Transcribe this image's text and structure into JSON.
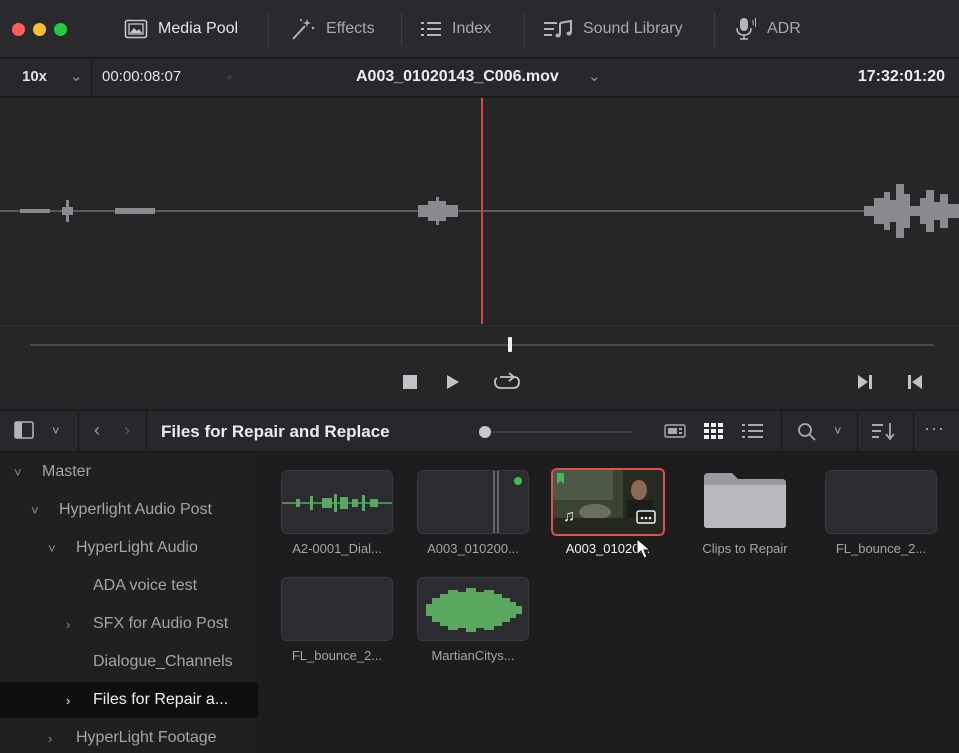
{
  "tabs": [
    {
      "label": "Media Pool",
      "icon": "media-pool-icon",
      "active": true
    },
    {
      "label": "Effects",
      "icon": "effects-wand-icon",
      "active": false
    },
    {
      "label": "Index",
      "icon": "index-list-icon",
      "active": false
    },
    {
      "label": "Sound Library",
      "icon": "sound-library-icon",
      "active": false
    },
    {
      "label": "ADR",
      "icon": "microphone-icon",
      "active": false
    }
  ],
  "viewer": {
    "zoom": "10x",
    "timecode": "00:00:08:07",
    "clip_name": "A003_01020143_C006.mov",
    "timecode_right": "17:32:01:20"
  },
  "media_pool": {
    "bin_title": "Files for Repair and Replace"
  },
  "sidebar": {
    "items": [
      {
        "label": "Master",
        "chev": "˅",
        "depth": 0
      },
      {
        "label": "Hyperlight Audio Post",
        "chev": "˅",
        "depth": 1
      },
      {
        "label": "HyperLight Audio",
        "chev": "˅",
        "depth": 2
      },
      {
        "label": "ADA voice test",
        "chev": "",
        "depth": 3
      },
      {
        "label": "SFX for Audio Post",
        "chev": "›",
        "depth": 3
      },
      {
        "label": "Dialogue_Channels",
        "chev": "",
        "depth": 3
      },
      {
        "label": "Files for Repair a...",
        "chev": "›",
        "depth": 3,
        "selected": true
      },
      {
        "label": "HyperLight Footage",
        "chev": "›",
        "depth": 2
      }
    ]
  },
  "clips": [
    {
      "label": "A2-0001_Dial..."
    },
    {
      "label": "A003_010200..."
    },
    {
      "label": "A003_01020..."
    },
    {
      "label": "Clips to Repair"
    },
    {
      "label": "FL_bounce_2..."
    },
    {
      "label": "FL_bounce_2..."
    },
    {
      "label": "MartianCitys..."
    }
  ],
  "colors": {
    "playhead": "#e1413f",
    "selection": "#e0504e",
    "waveform_green": "#5aa860",
    "clip_marker_green": "#3fbf4a"
  }
}
